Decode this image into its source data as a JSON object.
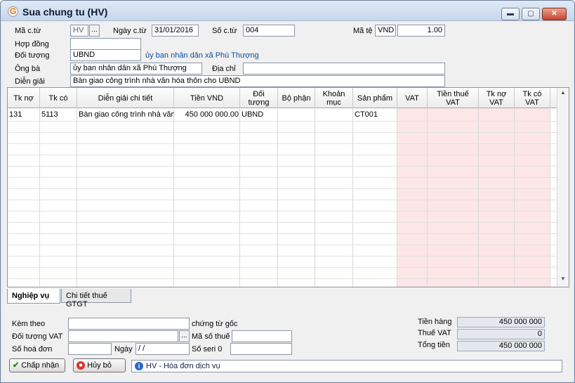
{
  "window": {
    "title": "Sua chung tu (HV)",
    "minimize": "▬",
    "maximize": "▢",
    "close": "✕"
  },
  "form": {
    "ma_ctu_label": "Mã c.từ",
    "ma_ctu_value": "HV",
    "browse": "...",
    "ngay_ctu_label": "Ngày c.từ",
    "ngay_ctu_value": "31/01/2016",
    "so_ctu_label": "Số c.từ",
    "so_ctu_value": "004",
    "ma_te_label": "Mã tệ",
    "ma_te_value": "VND",
    "ty_gia_value": "1.00",
    "hop_dong_label": "Hợp đồng",
    "hop_dong_value": "",
    "doi_tuong_label": "Đối tượng",
    "doi_tuong_value": "UBND",
    "doi_tuong_name": "ủy ban nhân dân xã Phú Thượng",
    "ong_ba_label": "Ông bà",
    "ong_ba_value": "ủy ban nhân dân xã Phú Thượng",
    "dia_chi_label": "Địa chỉ",
    "dia_chi_value": "",
    "dien_giai_label": "Diễn giải",
    "dien_giai_value": "Bàn giao công trình nhà văn hóa thôn cho UBND"
  },
  "grid": {
    "headers": [
      "Tk nợ",
      "Tk có",
      "Diễn giải chi tiết",
      "Tiền VND",
      "Đối tượng",
      "Bộ phận",
      "Khoản mục",
      "Sản phẩm",
      "VAT",
      "Tiền thuế VAT",
      "Tk nợ VAT",
      "Tk có VAT"
    ],
    "row1": {
      "tk_no": "131",
      "tk_co": "5113",
      "dien_giai": "Bàn giao công trình nhà văn",
      "tien": "450 000 000.00",
      "doi_tuong": "UBND",
      "san_pham": "CT001"
    },
    "scroll_up": "▲",
    "scroll_down": "▼"
  },
  "tabs": {
    "nghiep_vu": "Nghiệp vụ",
    "chi_tiet": "Chi tiết thuế GTGT"
  },
  "bottom": {
    "kem_theo_label": "Kèm theo",
    "kem_theo_value": "",
    "chung_tu_goc": "chứng từ gốc",
    "doi_tuong_vat_label": "Đối tượng VAT",
    "doi_tuong_vat_value": "",
    "browse": "...",
    "ma_so_thue_label": "Mã số thuế",
    "ma_so_thue_value": "",
    "so_hoa_don_label": "Số hoá đơn",
    "so_hoa_don_value": "",
    "ngay_label": "Ngày",
    "ngay_value": "/ /",
    "so_seri_label": "Số seri 0",
    "so_seri_value": "",
    "tien_hang_label": "Tiền hàng",
    "tien_hang_value": "450 000 000",
    "thue_vat_label": "Thuế VAT",
    "thue_vat_value": "0",
    "tong_tien_label": "Tổng tiền",
    "tong_tien_value": "450 000 000"
  },
  "buttons": {
    "accept": "Chấp nhận",
    "cancel": "Hủy bỏ"
  },
  "status": {
    "text": "HV - Hóa đơn dịch vụ"
  }
}
